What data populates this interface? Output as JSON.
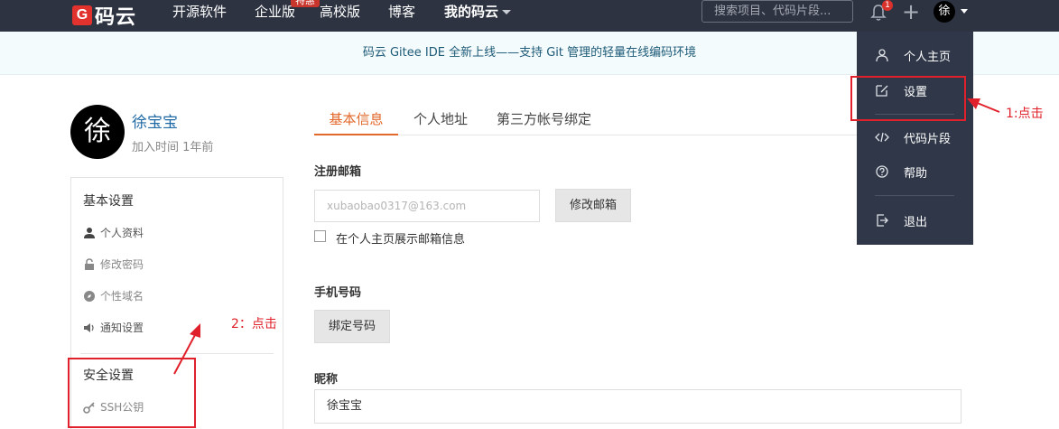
{
  "navbar": {
    "logo_mark": "G",
    "logo_text": "码云",
    "items": [
      "开源软件",
      "企业版",
      "高校版",
      "博客",
      "我的码云"
    ],
    "hot_badge": "特惠",
    "search_placeholder": "搜索项目、代码片段...",
    "notification_count": "1",
    "avatar_char": "徐"
  },
  "notice": {
    "text": "码云 Gitee IDE 全新上线——支持 Git 管理的轻量在线编码环境"
  },
  "profile": {
    "avatar_char": "徐",
    "name": "徐宝宝",
    "joined": "加入时间 1年前"
  },
  "sidebar": {
    "basic_title": "基本设置",
    "basic_items": [
      "个人资料",
      "修改密码",
      "个性域名",
      "通知设置"
    ],
    "security_title": "安全设置",
    "security_items": [
      "SSH公钥"
    ]
  },
  "tabs": [
    "基本信息",
    "个人地址",
    "第三方帐号绑定"
  ],
  "form": {
    "email_label": "注册邮箱",
    "email_value": "xubaobao0317@163.com",
    "change_email_button": "修改邮箱",
    "show_email_label": "在个人主页展示邮箱信息",
    "phone_label": "手机号码",
    "bind_phone_button": "绑定号码",
    "nickname_label": "昵称",
    "nickname_value": "徐宝宝"
  },
  "dropdown": {
    "items": [
      "个人主页",
      "设置",
      "代码片段",
      "帮助",
      "退出"
    ]
  },
  "annotations": {
    "step1": "1:点击",
    "step2": "2：点击"
  },
  "colors": {
    "navbar_bg": "#2d3341",
    "accent_orange": "#e2682b",
    "annotation_red": "#e0202a",
    "link_blue": "#1f6aa5"
  }
}
